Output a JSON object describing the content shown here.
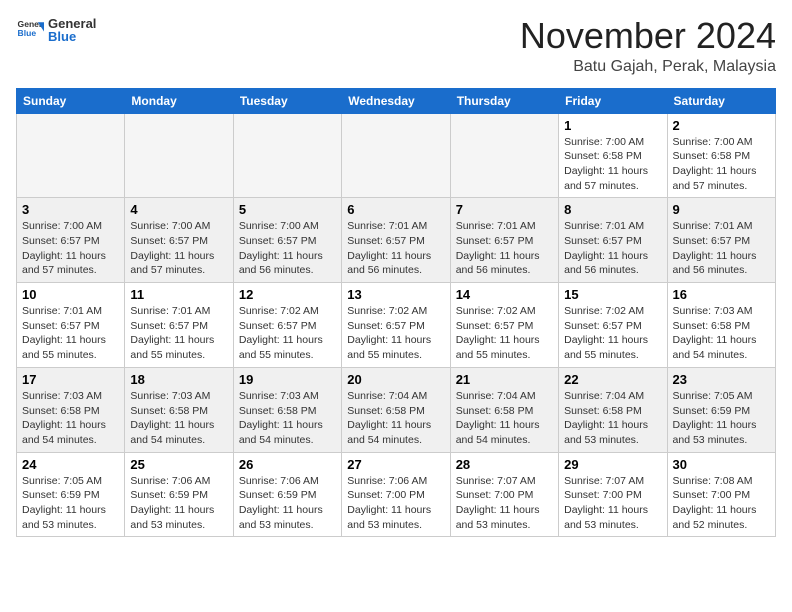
{
  "header": {
    "logo_general": "General",
    "logo_blue": "Blue",
    "month_title": "November 2024",
    "location": "Batu Gajah, Perak, Malaysia"
  },
  "days_of_week": [
    "Sunday",
    "Monday",
    "Tuesday",
    "Wednesday",
    "Thursday",
    "Friday",
    "Saturday"
  ],
  "weeks": [
    [
      {
        "day": "",
        "info": ""
      },
      {
        "day": "",
        "info": ""
      },
      {
        "day": "",
        "info": ""
      },
      {
        "day": "",
        "info": ""
      },
      {
        "day": "",
        "info": ""
      },
      {
        "day": "1",
        "info": "Sunrise: 7:00 AM\nSunset: 6:58 PM\nDaylight: 11 hours and 57 minutes."
      },
      {
        "day": "2",
        "info": "Sunrise: 7:00 AM\nSunset: 6:58 PM\nDaylight: 11 hours and 57 minutes."
      }
    ],
    [
      {
        "day": "3",
        "info": "Sunrise: 7:00 AM\nSunset: 6:57 PM\nDaylight: 11 hours and 57 minutes."
      },
      {
        "day": "4",
        "info": "Sunrise: 7:00 AM\nSunset: 6:57 PM\nDaylight: 11 hours and 57 minutes."
      },
      {
        "day": "5",
        "info": "Sunrise: 7:00 AM\nSunset: 6:57 PM\nDaylight: 11 hours and 56 minutes."
      },
      {
        "day": "6",
        "info": "Sunrise: 7:01 AM\nSunset: 6:57 PM\nDaylight: 11 hours and 56 minutes."
      },
      {
        "day": "7",
        "info": "Sunrise: 7:01 AM\nSunset: 6:57 PM\nDaylight: 11 hours and 56 minutes."
      },
      {
        "day": "8",
        "info": "Sunrise: 7:01 AM\nSunset: 6:57 PM\nDaylight: 11 hours and 56 minutes."
      },
      {
        "day": "9",
        "info": "Sunrise: 7:01 AM\nSunset: 6:57 PM\nDaylight: 11 hours and 56 minutes."
      }
    ],
    [
      {
        "day": "10",
        "info": "Sunrise: 7:01 AM\nSunset: 6:57 PM\nDaylight: 11 hours and 55 minutes."
      },
      {
        "day": "11",
        "info": "Sunrise: 7:01 AM\nSunset: 6:57 PM\nDaylight: 11 hours and 55 minutes."
      },
      {
        "day": "12",
        "info": "Sunrise: 7:02 AM\nSunset: 6:57 PM\nDaylight: 11 hours and 55 minutes."
      },
      {
        "day": "13",
        "info": "Sunrise: 7:02 AM\nSunset: 6:57 PM\nDaylight: 11 hours and 55 minutes."
      },
      {
        "day": "14",
        "info": "Sunrise: 7:02 AM\nSunset: 6:57 PM\nDaylight: 11 hours and 55 minutes."
      },
      {
        "day": "15",
        "info": "Sunrise: 7:02 AM\nSunset: 6:57 PM\nDaylight: 11 hours and 55 minutes."
      },
      {
        "day": "16",
        "info": "Sunrise: 7:03 AM\nSunset: 6:58 PM\nDaylight: 11 hours and 54 minutes."
      }
    ],
    [
      {
        "day": "17",
        "info": "Sunrise: 7:03 AM\nSunset: 6:58 PM\nDaylight: 11 hours and 54 minutes."
      },
      {
        "day": "18",
        "info": "Sunrise: 7:03 AM\nSunset: 6:58 PM\nDaylight: 11 hours and 54 minutes."
      },
      {
        "day": "19",
        "info": "Sunrise: 7:03 AM\nSunset: 6:58 PM\nDaylight: 11 hours and 54 minutes."
      },
      {
        "day": "20",
        "info": "Sunrise: 7:04 AM\nSunset: 6:58 PM\nDaylight: 11 hours and 54 minutes."
      },
      {
        "day": "21",
        "info": "Sunrise: 7:04 AM\nSunset: 6:58 PM\nDaylight: 11 hours and 54 minutes."
      },
      {
        "day": "22",
        "info": "Sunrise: 7:04 AM\nSunset: 6:58 PM\nDaylight: 11 hours and 53 minutes."
      },
      {
        "day": "23",
        "info": "Sunrise: 7:05 AM\nSunset: 6:59 PM\nDaylight: 11 hours and 53 minutes."
      }
    ],
    [
      {
        "day": "24",
        "info": "Sunrise: 7:05 AM\nSunset: 6:59 PM\nDaylight: 11 hours and 53 minutes."
      },
      {
        "day": "25",
        "info": "Sunrise: 7:06 AM\nSunset: 6:59 PM\nDaylight: 11 hours and 53 minutes."
      },
      {
        "day": "26",
        "info": "Sunrise: 7:06 AM\nSunset: 6:59 PM\nDaylight: 11 hours and 53 minutes."
      },
      {
        "day": "27",
        "info": "Sunrise: 7:06 AM\nSunset: 7:00 PM\nDaylight: 11 hours and 53 minutes."
      },
      {
        "day": "28",
        "info": "Sunrise: 7:07 AM\nSunset: 7:00 PM\nDaylight: 11 hours and 53 minutes."
      },
      {
        "day": "29",
        "info": "Sunrise: 7:07 AM\nSunset: 7:00 PM\nDaylight: 11 hours and 53 minutes."
      },
      {
        "day": "30",
        "info": "Sunrise: 7:08 AM\nSunset: 7:00 PM\nDaylight: 11 hours and 52 minutes."
      }
    ]
  ]
}
